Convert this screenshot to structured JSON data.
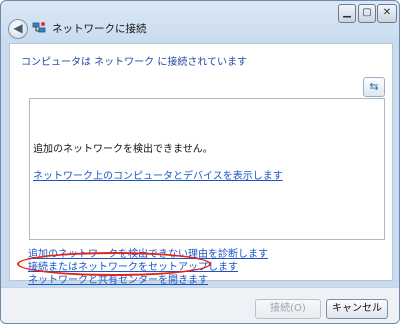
{
  "window": {
    "title": "ネットワークに接続",
    "controls": {
      "minimize": "▁",
      "maximize": "▢",
      "close": "✕"
    },
    "back_icon": "back-arrow-icon",
    "app_icon": "network-icon"
  },
  "main": {
    "status_text": "コンピュータは ネットワーク に接続されています",
    "refresh_icon": "refresh-icon",
    "refresh_glyph": "⇆",
    "no_networks_text": "追加のネットワークを検出できません。",
    "show_link": "ネットワーク上のコンピュータとデバイスを表示します"
  },
  "links": [
    "追加のネットワークを検出できない理由を診断します",
    "接続またはネットワークをセットアップします",
    "ネットワークと共有センターを開きます"
  ],
  "annotation": {
    "color": "#e0261c"
  },
  "footer": {
    "connect_label": "接続(O)",
    "cancel_label": "キャンセル"
  },
  "colors": {
    "link": "#1a55c5",
    "status": "#2248a6"
  }
}
